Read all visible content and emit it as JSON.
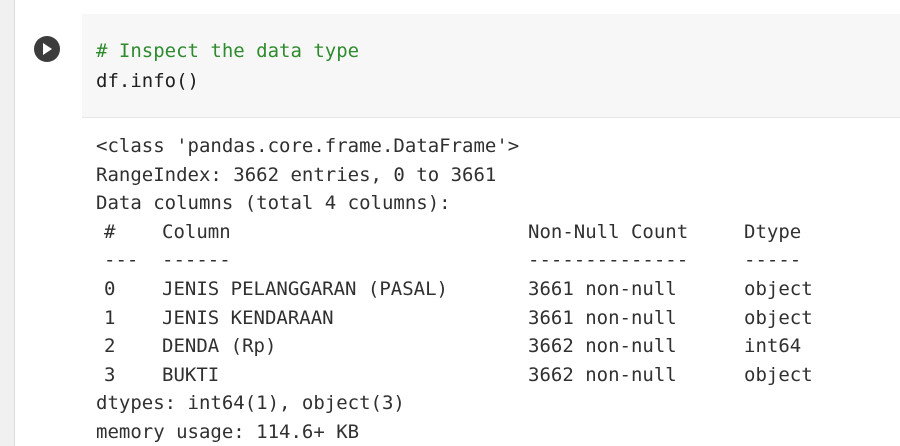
{
  "cell": {
    "run_icon": "play-circle-icon",
    "code_lines": [
      {
        "text": "# Inspect the data type",
        "kind": "comment"
      },
      {
        "text": "df.info()",
        "kind": "code"
      }
    ]
  },
  "output": {
    "class_line": "<class 'pandas.core.frame.DataFrame'>",
    "range_line": "RangeIndex: 3662 entries, 0 to 3661",
    "columns_line": "Data columns (total 4 columns):",
    "header": {
      "idx": "#",
      "column": "Column",
      "count": "Non-Null Count",
      "dtype": "Dtype"
    },
    "separator": {
      "idx": "---",
      "column": "------",
      "count": "--------------",
      "dtype": "-----"
    },
    "rows": [
      {
        "idx": "0",
        "column": "JENIS PELANGGARAN (PASAL)",
        "count": "3661 non-null",
        "dtype": "object"
      },
      {
        "idx": "1",
        "column": "JENIS KENDARAAN",
        "count": "3661 non-null",
        "dtype": "object"
      },
      {
        "idx": "2",
        "column": "DENDA (Rp)",
        "count": "3662 non-null",
        "dtype": "int64"
      },
      {
        "idx": "3",
        "column": "BUKTI",
        "count": "3662 non-null",
        "dtype": "object"
      }
    ],
    "dtypes_line": "dtypes: int64(1), object(3)",
    "memory_line": "memory usage: 114.6+ KB"
  }
}
